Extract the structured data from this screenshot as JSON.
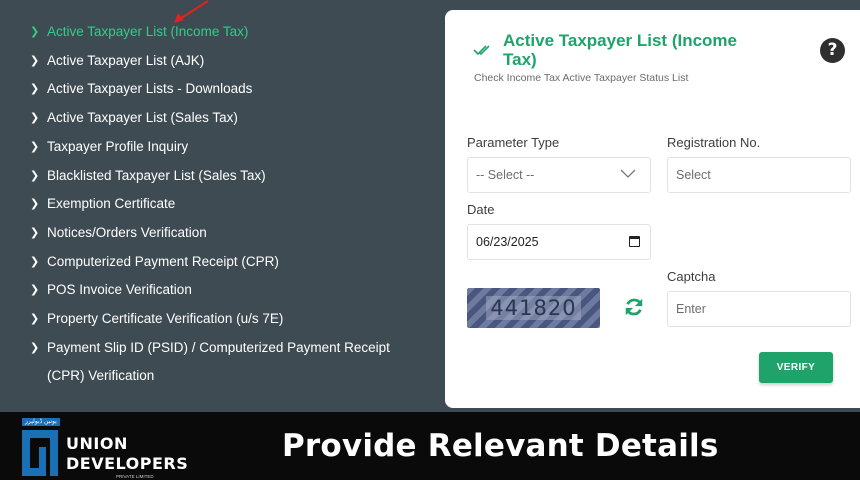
{
  "sidebar": {
    "items": [
      {
        "label": "Active Taxpayer List (Income Tax)"
      },
      {
        "label": "Active Taxpayer List (AJK)"
      },
      {
        "label": "Active Taxpayer Lists - Downloads"
      },
      {
        "label": "Active Taxpayer List (Sales Tax)"
      },
      {
        "label": "Taxpayer Profile Inquiry"
      },
      {
        "label": "Blacklisted Taxpayer List (Sales Tax)"
      },
      {
        "label": "Exemption Certificate"
      },
      {
        "label": "Notices/Orders Verification"
      },
      {
        "label": "Computerized Payment Receipt (CPR)"
      },
      {
        "label": "POS Invoice Verification"
      },
      {
        "label": "Property Certificate Verification (u/s 7E)"
      },
      {
        "label": "Payment Slip ID (PSID) / Computerized Payment Receipt (CPR) Verification"
      }
    ],
    "active_index": 0,
    "chevron_icon": "chevron-right-icon"
  },
  "form": {
    "title": "Active Taxpayer List (Income Tax)",
    "subtitle": "Check Income Tax Active Taxpayer Status List",
    "help_icon": "question-circle-icon",
    "parameter_type": {
      "label": "Parameter Type",
      "value": "-- Select --"
    },
    "registration": {
      "label": "Registration No.",
      "placeholder": "Select"
    },
    "date": {
      "label": "Date",
      "value": "06/23/2025"
    },
    "captcha": {
      "label": "Captcha",
      "placeholder": "Enter",
      "code": "441820"
    },
    "verify_label": "VERIFY"
  },
  "banner": {
    "text": "Provide Relevant Details",
    "logo_line1": "UNION",
    "logo_line2": "DEVELOPERS",
    "logo_sub": "PRIVATE LIMITED",
    "logo_urdu": "یونین ڈیولپرز"
  },
  "colors": {
    "accent": "#1fa36b",
    "active_item": "#2ecf8a",
    "sidebar_bg": "#3e4b52",
    "banner_bg": "#0a0a0a"
  }
}
